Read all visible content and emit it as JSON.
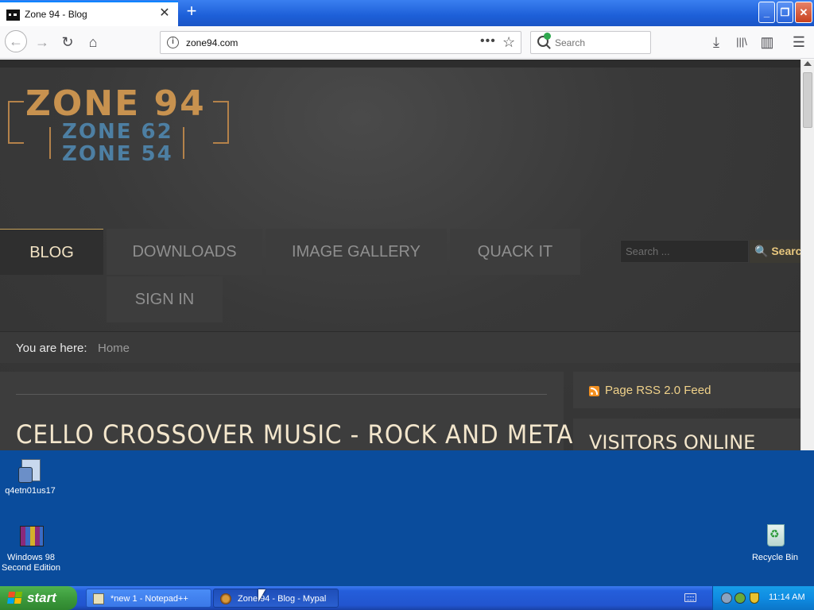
{
  "browser": {
    "tab_title": "Zone 94 - Blog",
    "tab_close": "✕",
    "new_tab": "+",
    "url": "zone94.com",
    "url_info": "i",
    "url_dots": "•••",
    "url_star": "☆",
    "search_placeholder": "Search",
    "icons": {
      "back": "←",
      "forward": "→",
      "reload": "↻",
      "home": "⌂",
      "download": "⤓",
      "library": "|||\\",
      "sidebar": "▥",
      "menu": "☰"
    },
    "window_buttons": {
      "minimize": "_",
      "maximize": "❐",
      "close": "✕"
    }
  },
  "site": {
    "logo": {
      "main": "ZONE 94",
      "line2": "ZONE 62",
      "line3": "ZONE 54"
    },
    "menu": {
      "blog": "BLOG",
      "downloads": "DOWNLOADS",
      "gallery": "IMAGE GALLERY",
      "quack": "QUACK IT",
      "signin": "SIGN IN"
    },
    "search": {
      "placeholder": "Search ...",
      "button": "🔍 Search"
    },
    "breadcrumb": {
      "label": "You are here:",
      "home": "Home"
    },
    "post_title": "CELLO CROSSOVER MUSIC - ROCK AND METAL",
    "sidebar": {
      "rss": "Page RSS 2.0 Feed",
      "visitors_title": "VISITORS ONLINE"
    }
  },
  "desktop": {
    "icons": [
      {
        "label": "q4etn01us17"
      },
      {
        "label": "Windows 98 Second Edition"
      },
      {
        "label": "Recycle Bin"
      }
    ]
  },
  "taskbar": {
    "start": "start",
    "tasks": [
      {
        "label": "*new 1 - Notepad++"
      },
      {
        "label": "Zone 94 - Blog - Mypal"
      }
    ],
    "clock": "11:14 AM"
  },
  "colors": {
    "accent_gold": "#c8924f",
    "logo_blue": "#4d7fa3",
    "desktop_blue": "#0a4c9c",
    "start_green": "#3c9a3c"
  }
}
